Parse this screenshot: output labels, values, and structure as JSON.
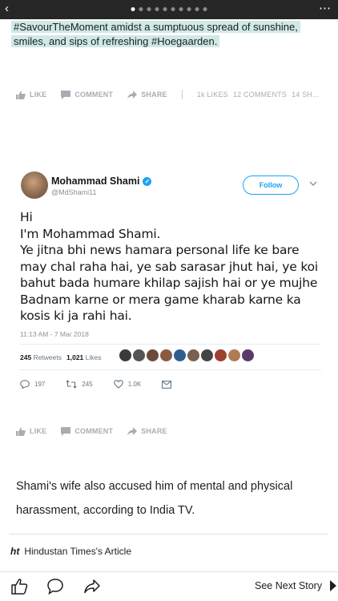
{
  "topbar": {
    "page_count": 10,
    "active_index": 0
  },
  "caption": {
    "text": "#SavourTheMoment amidst a sumptuous spread of sunshine, smiles, and sips of refreshing #Hoegaarden."
  },
  "action_bar_top": {
    "like": "LIKE",
    "comment": "COMMENT",
    "share": "SHARE",
    "likes_count": "1k LIKES",
    "comments_count": "12 COMMENTS",
    "shares_count": "14 SH..."
  },
  "tweet": {
    "author_name": "Mohammad Shami",
    "handle": "@MdShami11",
    "follow_label": "Follow",
    "body_lines": [
      "Hi",
      "I'm Mohammad Shami.",
      "Ye jitna bhi news hamara personal life ke bare may chal raha hai, ye sab sarasar jhut hai, ye koi bahut bada humare khilap sajish hai or ye mujhe Badnam karne or mera game kharab karne ka kosis ki ja rahi hai."
    ],
    "timestamp": "11:13 AM - 7 Mar 2018",
    "retweets_count": "245",
    "retweets_label": "Retweets",
    "likes_count": "1,021",
    "likes_label": "Likes",
    "reply_count": "197",
    "retweet_action_count": "245",
    "like_action_count": "1.0K"
  },
  "action_bar_bottom": {
    "like": "LIKE",
    "comment": "COMMENT",
    "share": "SHARE"
  },
  "article": {
    "text": "Shami's wife also accused him of mental and physical harassment, according to India TV."
  },
  "source": {
    "logo": "ht",
    "label": "Hindustan Times's Article"
  },
  "bottombar": {
    "next_label": "See Next Story"
  },
  "colors": {
    "caption_highlight": "#cfe9e6",
    "twitter_blue": "#1da1f2",
    "topbar": "#262626"
  }
}
